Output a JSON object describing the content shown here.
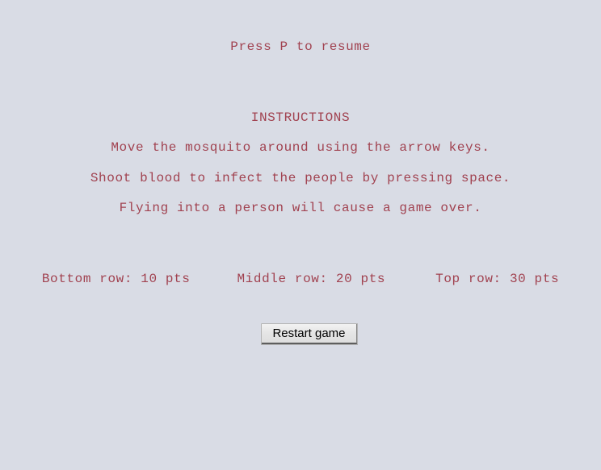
{
  "screen": {
    "background_color": "#d9dce5",
    "text_color": "#a14250",
    "resume_hint": "Press P to resume",
    "instructions_heading": "INSTRUCTIONS",
    "instruction_lines": [
      "Move the mosquito around using the arrow keys.",
      "Shoot blood to infect the people by pressing space.",
      "Flying into a person will cause a game over."
    ],
    "scoring": [
      "Bottom row: 10 pts",
      "Middle row: 20 pts",
      "Top row: 30 pts"
    ],
    "restart_button_label": "Restart game"
  }
}
